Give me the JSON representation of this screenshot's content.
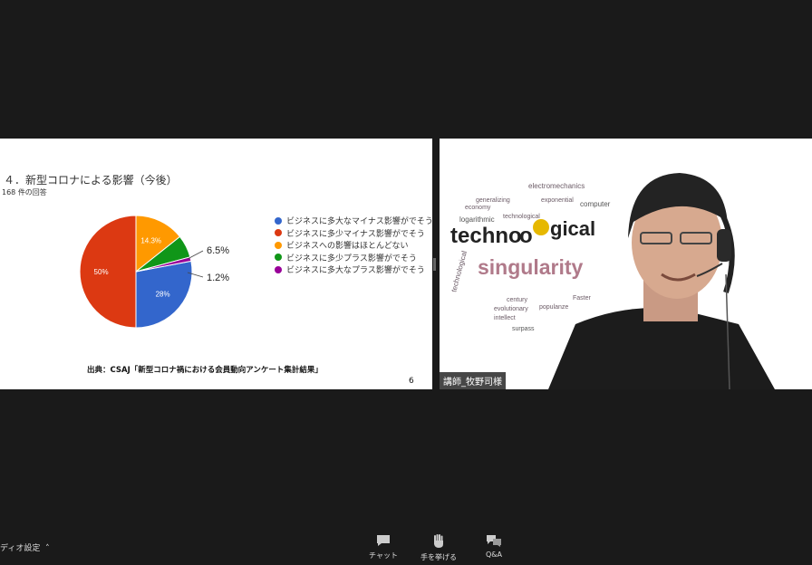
{
  "share": {
    "title": "４．新型コロナによる影響（今後）",
    "responses": "168 件の回答",
    "source": "出典：CSAJ「新型コロナ禍における会員動向アンケート集計結果」",
    "page": "6"
  },
  "chart_data": {
    "type": "pie",
    "title": "４．新型コロナによる影響（今後）",
    "categories": [
      "ビジネスに多大なマイナス影響がでそう",
      "ビジネスに多少マイナス影響がでそう",
      "ビジネスへの影響はほとんどない",
      "ビジネスに多少プラス影響がでそう",
      "ビジネスに多大なプラス影響がでそう"
    ],
    "values": [
      28,
      50,
      14.3,
      6.5,
      1.2
    ],
    "labels": [
      "28%",
      "50%",
      "14.3%",
      "6.5%",
      "1.2%"
    ],
    "colors": [
      "#3366cc",
      "#dc3912",
      "#ff9900",
      "#109618",
      "#990099"
    ],
    "legend": "right"
  },
  "video": {
    "name": "講師_牧野司様"
  },
  "toolbar": {
    "audio_settings": "ディオ設定",
    "chat": "チャット",
    "raise_hand": "手を挙げる",
    "qa": "Q&A"
  }
}
